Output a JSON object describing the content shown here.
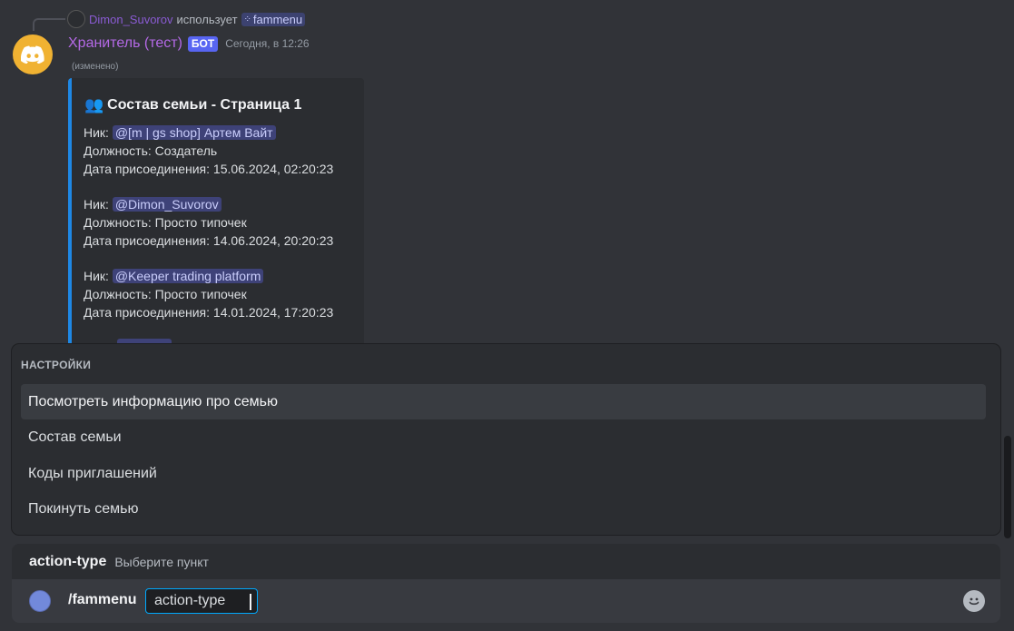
{
  "reply": {
    "username": "Dimon_Suvorov",
    "uses_text": "использует",
    "command": "fammenu"
  },
  "message": {
    "author": "Хранитель (тест)",
    "bot_tag": "БОТ",
    "timestamp": "Сегодня, в 12:26",
    "edited": "(изменено)",
    "embed": {
      "title_icon": "👥",
      "title": "Состав семьи - Страница 1",
      "accent_color": "#1e88e5",
      "members": [
        {
          "nick_label": "Ник:",
          "nick": "@[m | gs shop] Артем Вайт",
          "role_line": "Должность: Создатель",
          "joined_line": "Дата присоединения: 15.06.2024, 02:20:23"
        },
        {
          "nick_label": "Ник:",
          "nick": "@Dimon_Suvorov",
          "role_line": "Должность: Просто типочек",
          "joined_line": "Дата присоединения: 14.06.2024, 20:20:23"
        },
        {
          "nick_label": "Ник:",
          "nick": "@Keeper trading platform",
          "role_line": "Должность: Просто типочек",
          "joined_line": "Дата присоединения: 14.01.2024, 17:20:23"
        }
      ]
    }
  },
  "autocomplete": {
    "title": "НАСТРОЙКИ",
    "items": [
      {
        "label": "Посмотреть информацию про семью",
        "active": true
      },
      {
        "label": "Состав семьи",
        "active": false
      },
      {
        "label": "Коды приглашений",
        "active": false
      },
      {
        "label": "Покинуть семью",
        "active": false
      }
    ]
  },
  "option_hint": {
    "name": "action-type",
    "description": "Выберите пункт"
  },
  "composer": {
    "command": "/fammenu",
    "param_value": "action-type"
  },
  "colors": {
    "background": "#313338",
    "author": "#b469e6",
    "bot_tag": "#5865f2",
    "mention_bg": "#3e4278",
    "focus_border": "#00a8fc"
  }
}
